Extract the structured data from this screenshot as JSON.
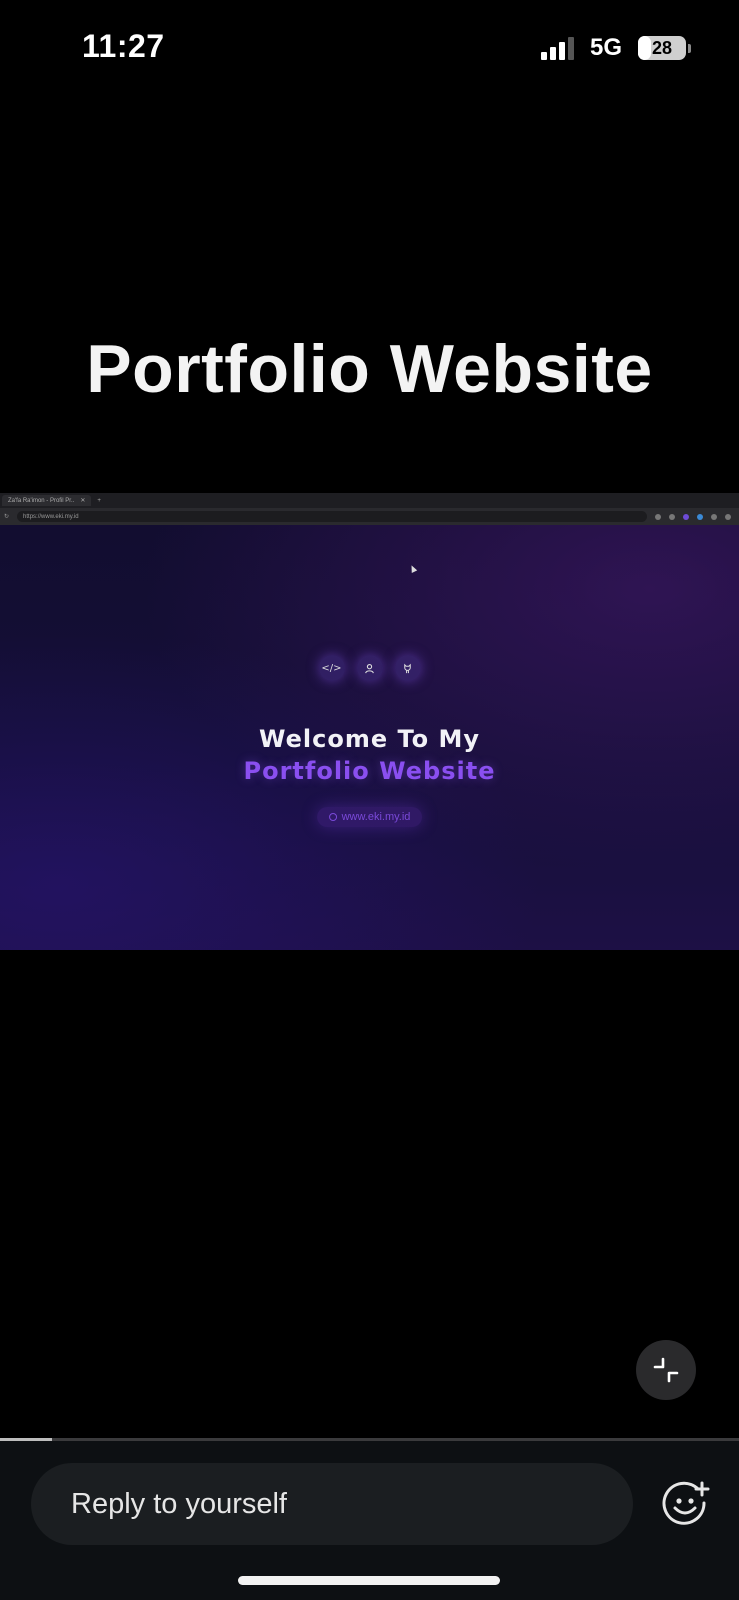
{
  "status_bar": {
    "time": "11:27",
    "network": "5G",
    "battery_level": "28",
    "signal_bars": 3
  },
  "story": {
    "title": "Portfolio Website",
    "progress_fraction": 0.07
  },
  "embedded_site": {
    "tab_label": "Za'fa Ra'imon - Profil Pr..",
    "address": "https://www.eki.my.id",
    "hero_icons": [
      "code-icon",
      "user-icon",
      "github-icon"
    ],
    "hero_line1": "Welcome To My",
    "hero_line2": "Portfolio Website",
    "hero_url": "www.eki.my.id",
    "accent_color": "#8a4ff0"
  },
  "reply": {
    "placeholder": "Reply to yourself"
  }
}
